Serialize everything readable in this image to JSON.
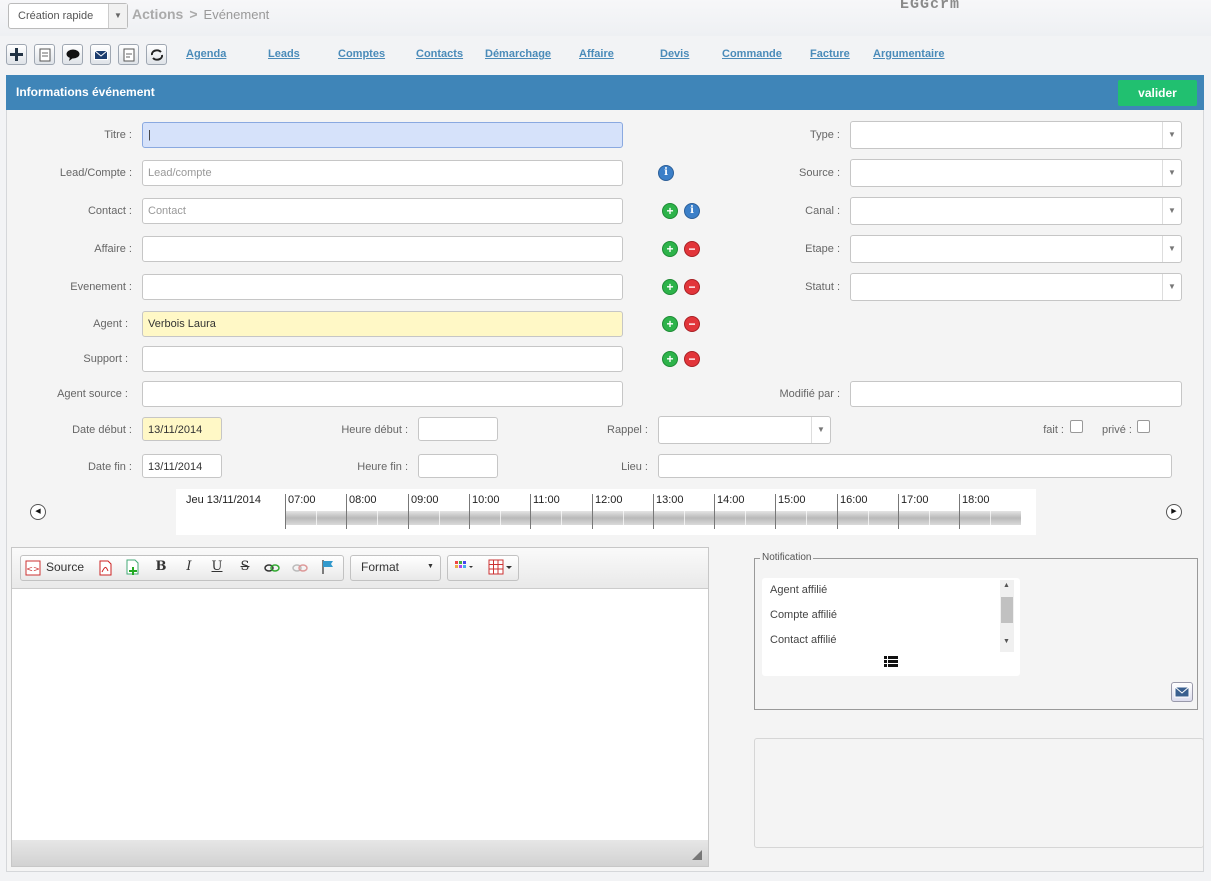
{
  "topbar": {
    "quick_create": "Création rapide",
    "breadcrumb": [
      "Actions",
      "Evénement"
    ],
    "breadcrumb_sep": ">",
    "logo": "EGGcrm"
  },
  "toolbar": {
    "icons": [
      "plus-icon",
      "document-icon",
      "comment-icon",
      "mail-icon",
      "note-icon",
      "sync-icon"
    ]
  },
  "nav": [
    "Agenda",
    "Leads",
    "Comptes",
    "Contacts",
    "Démarchage",
    "Affaire",
    "Devis",
    "Commande",
    "Facture",
    "Argumentaire"
  ],
  "header": {
    "title": "Informations événement",
    "submit": "valider"
  },
  "form": {
    "titre_label": "Titre :",
    "titre_value": "|",
    "lead_label": "Lead/Compte :",
    "lead_placeholder": "Lead/compte",
    "contact_label": "Contact :",
    "contact_placeholder": "Contact",
    "affaire_label": "Affaire :",
    "evenement_label": "Evenement :",
    "agent_label": "Agent :",
    "agent_value": "Verbois Laura",
    "support_label": "Support :",
    "agent_source_label": "Agent source :",
    "type_label": "Type :",
    "source_label": "Source :",
    "canal_label": "Canal :",
    "etape_label": "Etape :",
    "statut_label": "Statut :",
    "modifie_label": "Modifié par :",
    "date_debut_label": "Date début :",
    "date_debut_value": "13/11/2014",
    "heure_debut_label": "Heure début :",
    "rappel_label": "Rappel :",
    "fait_label": "fait :",
    "prive_label": "privé :",
    "date_fin_label": "Date fin :",
    "date_fin_value": "13/11/2014",
    "heure_fin_label": "Heure fin :",
    "lieu_label": "Lieu :"
  },
  "timeline": {
    "day": "Jeu 13/11/2014",
    "hours": [
      "07:00",
      "08:00",
      "09:00",
      "10:00",
      "11:00",
      "12:00",
      "13:00",
      "14:00",
      "15:00",
      "16:00",
      "17:00",
      "18:00"
    ]
  },
  "editor": {
    "source_label": "Source",
    "format_label": "Format",
    "bold": "B",
    "italic": "I",
    "underline": "U",
    "strike": "S"
  },
  "notification": {
    "legend": "Notification",
    "items": [
      "Agent affilié",
      "Compte affilié",
      "Contact affilié"
    ]
  },
  "colors": {
    "header": "#3f85b8",
    "submit": "#21c070",
    "nav_link": "#4a8bb9",
    "highlight_yellow": "#fff8c6",
    "focus_blue": "#d6e2fa"
  }
}
